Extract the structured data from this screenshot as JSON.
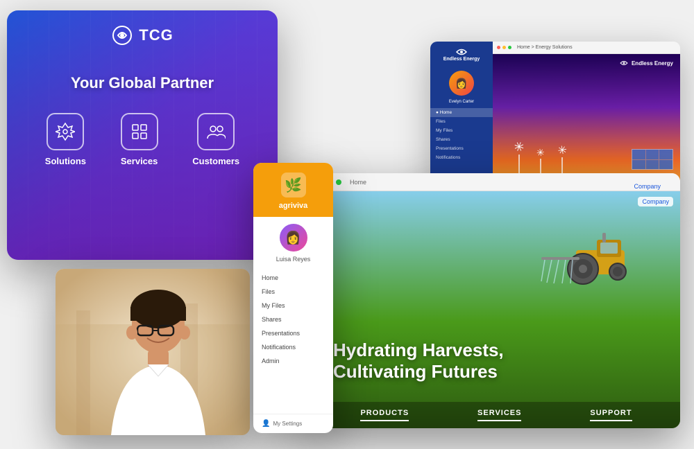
{
  "tcg": {
    "logo_text": "TCG",
    "tagline": "Your Global Partner",
    "nav_items": [
      {
        "icon": "✦",
        "label": "Solutions"
      },
      {
        "icon": "◈",
        "label": "Services"
      },
      {
        "icon": "⊕",
        "label": "Customers"
      }
    ]
  },
  "energy": {
    "brand": "Endless Energy",
    "sidebar": {
      "user": "Evelyn Carter",
      "nav": [
        "Home",
        "Files",
        "My Files",
        "Shares",
        "Presentations",
        "Notifications"
      ]
    },
    "topbar": {
      "breadcrumb": "Home > Energy Solutions"
    }
  },
  "agriviva": {
    "name": "agriviva",
    "user": "Luisa Reyes",
    "nav": [
      "Home",
      "Files",
      "My Files",
      "Shares",
      "Presentations",
      "Notifications",
      "Admin"
    ],
    "footer": "My Settings"
  },
  "farm": {
    "topbar_url": "Home",
    "company_link": "Company",
    "headline_line1": "Hydrating Harvests,",
    "headline_line2": "Cultivating Futures",
    "nav": [
      "PRODUCTS",
      "SERVICES",
      "SUPPORT"
    ]
  },
  "colors": {
    "tcg_gradient_start": "#2563eb",
    "tcg_gradient_end": "#9333ea",
    "energy_sidebar": "#1a3a8f",
    "agriviva_header": "#f59e0b",
    "dot_red": "#ff5f57",
    "dot_yellow": "#ffbd2e",
    "dot_green": "#28c840"
  }
}
